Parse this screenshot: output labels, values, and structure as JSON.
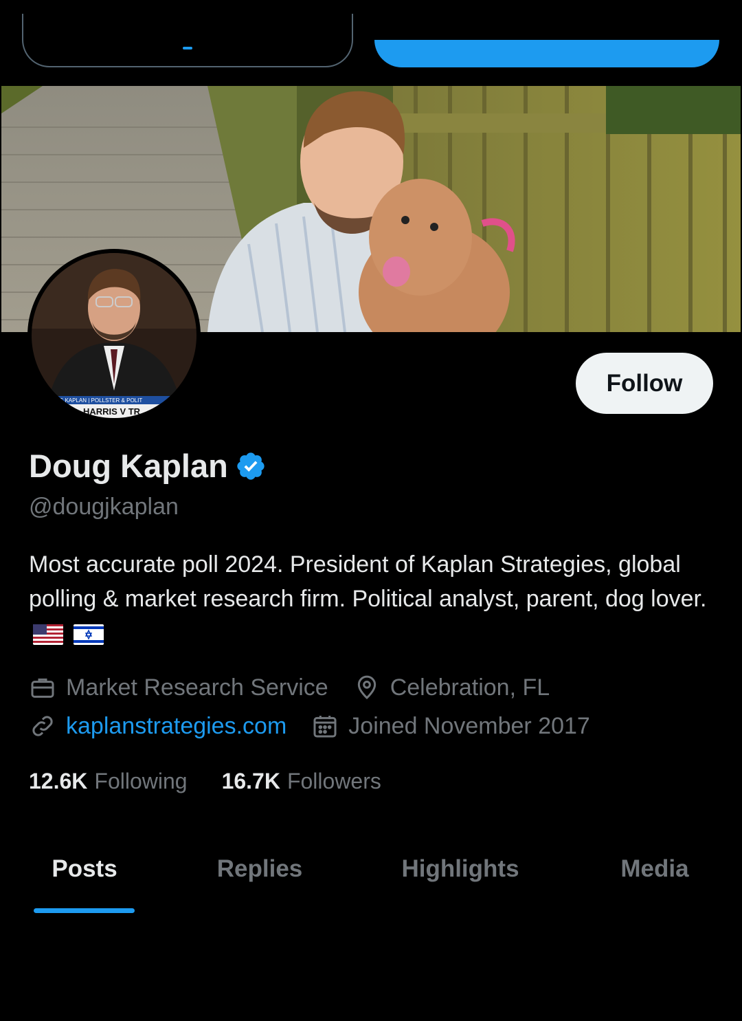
{
  "colors": {
    "accent": "#1d9bf0",
    "background": "#000000",
    "text": "#e7e9ea",
    "secondary": "#71767b"
  },
  "profile": {
    "name": "Doug Kaplan",
    "handle": "@dougjkaplan",
    "verified": true,
    "bio": "Most accurate poll 2024. President of Kaplan Strategies, global polling & market research firm. Political analyst, parent, dog lover.",
    "bio_flags": [
      "us-flag-icon",
      "israel-flag-icon"
    ],
    "avatar_caption_line1": "G KAPLAN | POLLSTER & POLIT",
    "avatar_caption_line2": "HARRIS V TR"
  },
  "actions": {
    "follow_label": "Follow"
  },
  "meta": {
    "category": "Market Research Service",
    "location": "Celebration, FL",
    "website": "kaplanstrategies.com",
    "joined": "Joined November 2017"
  },
  "stats": {
    "following_count": "12.6K",
    "following_label": "Following",
    "followers_count": "16.7K",
    "followers_label": "Followers"
  },
  "tabs": [
    {
      "label": "Posts",
      "active": true
    },
    {
      "label": "Replies",
      "active": false
    },
    {
      "label": "Highlights",
      "active": false
    },
    {
      "label": "Media",
      "active": false
    }
  ]
}
